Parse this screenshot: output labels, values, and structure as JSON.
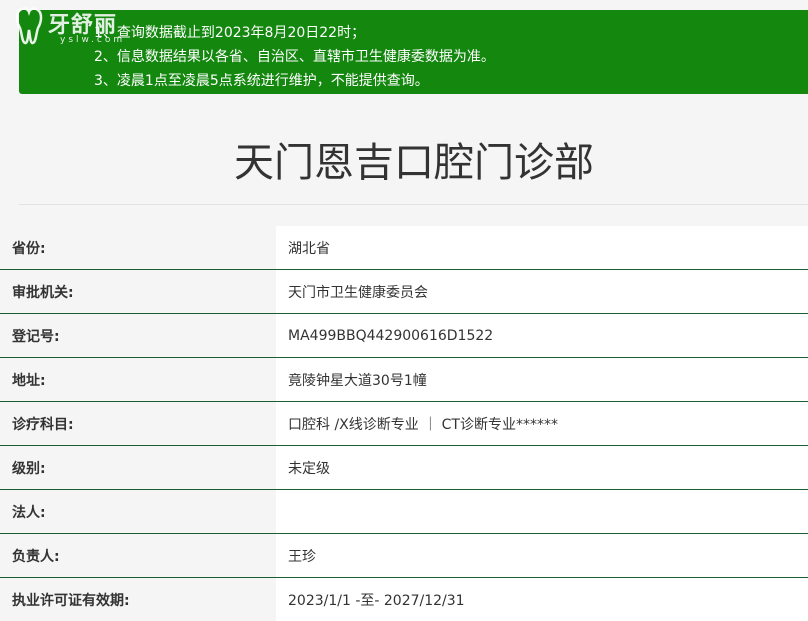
{
  "notice": {
    "lines": [
      "1、查询数据截止到2023年8月20日22时；",
      "2、信息数据结果以各省、自治区、直辖市卫生健康委数据为准。",
      "3、凌晨1点至凌晨5点系统进行维护，不能提供查询。"
    ],
    "background": "#14870f"
  },
  "logo": {
    "text": "牙舒丽",
    "subtext": "yslw.com"
  },
  "clinic": {
    "name": "天门恩吉口腔门诊部"
  },
  "fields": [
    {
      "label": "省份:",
      "value": "湖北省"
    },
    {
      "label": "审批机关:",
      "value": "天门市卫生健康委员会"
    },
    {
      "label": "登记号:",
      "value": "MA499BBQ442900616D1522"
    },
    {
      "label": "地址:",
      "value": "竟陵钟星大道30号1幢"
    },
    {
      "label": "诊疗科目:",
      "value": "口腔科 /X线诊断专业 ｜ CT诊断专业******"
    },
    {
      "label": "级别:",
      "value": "未定级"
    },
    {
      "label": "法人:",
      "value": ""
    },
    {
      "label": "负责人:",
      "value": "王珍"
    },
    {
      "label": "执业许可证有效期:",
      "value": "2023/1/1 -至- 2027/12/31"
    }
  ],
  "colors": {
    "row_border": "#1a5c33",
    "label_bg": "#f5f5f5",
    "value_bg": "#ffffff"
  }
}
